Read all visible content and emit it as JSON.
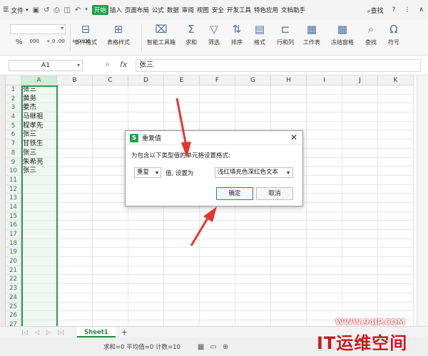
{
  "menubar": {
    "file_label": "文件",
    "tabs": [
      "插入",
      "页面布局",
      "公式",
      "数据",
      "审阅",
      "视图",
      "安全",
      "开发工具",
      "特色应用",
      "文档助手"
    ],
    "active_tab": "开始",
    "search_label": "查找"
  },
  "ribbon": {
    "buttons": [
      "条件格式",
      "表格样式",
      "智能工具箱",
      "求和",
      "筛选",
      "排序",
      "格式",
      "行和列",
      "工作表",
      "冻结窗格",
      "查找",
      "符号"
    ],
    "num_format_symbols": [
      "%",
      "000",
      "+.0 .00",
      "+.0 .00"
    ]
  },
  "formula_bar": {
    "cell_ref": "A1",
    "fx": "fx",
    "value": "张三"
  },
  "columns": [
    "A",
    "B",
    "C",
    "D",
    "E",
    "F",
    "G",
    "H",
    "I",
    "J",
    "K"
  ],
  "selected_column": "A",
  "rows": [
    {
      "n": "1",
      "a": "张三"
    },
    {
      "n": "2",
      "a": "黄务"
    },
    {
      "n": "3",
      "a": "姜杰"
    },
    {
      "n": "4",
      "a": "马继祖"
    },
    {
      "n": "5",
      "a": "程孝先"
    },
    {
      "n": "6",
      "a": "张三"
    },
    {
      "n": "7",
      "a": "甘铁生"
    },
    {
      "n": "8",
      "a": "张三"
    },
    {
      "n": "9",
      "a": "朱希亮"
    },
    {
      "n": "10",
      "a": "张三"
    },
    {
      "n": "11",
      "a": ""
    },
    {
      "n": "12",
      "a": ""
    },
    {
      "n": "13",
      "a": ""
    },
    {
      "n": "14",
      "a": ""
    },
    {
      "n": "15",
      "a": ""
    },
    {
      "n": "16",
      "a": ""
    },
    {
      "n": "17",
      "a": ""
    },
    {
      "n": "18",
      "a": ""
    },
    {
      "n": "19",
      "a": ""
    },
    {
      "n": "20",
      "a": ""
    },
    {
      "n": "21",
      "a": ""
    },
    {
      "n": "22",
      "a": ""
    },
    {
      "n": "23",
      "a": ""
    },
    {
      "n": "24",
      "a": ""
    },
    {
      "n": "25",
      "a": ""
    },
    {
      "n": "26",
      "a": ""
    },
    {
      "n": "27",
      "a": ""
    }
  ],
  "sheet_tab": "Sheet1",
  "status": {
    "text": "求和=0  平均值=0  计数=10"
  },
  "dialog": {
    "title": "重复值",
    "prompt": "为包含以下类型值的单元格设置格式:",
    "rule": "重复",
    "mid_text": "值, 设置为",
    "format": "浅红填充色深红色文本",
    "ok": "确定",
    "cancel": "取消"
  },
  "watermark": {
    "url": "WWW.94IP.COM",
    "brand": "IT运维空间"
  },
  "colors": {
    "accent_green": "#1fa24a",
    "arrow_red": "#e8352b"
  }
}
